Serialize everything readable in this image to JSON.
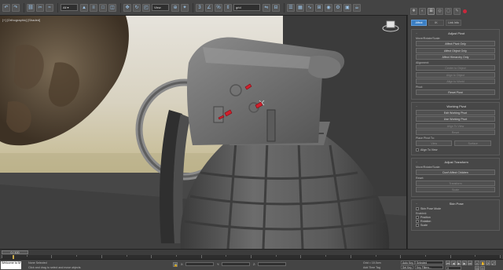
{
  "toolbar": {
    "view_select": "View",
    "layer_select": "grid",
    "icons": [
      "undo-icon",
      "redo-icon",
      "link-icon",
      "unlink-icon",
      "bind-icon",
      "select-icon",
      "select-by-name-icon",
      "region-icon",
      "move-icon",
      "rotate-icon",
      "scale-icon",
      "reference-icon",
      "pivot-icon",
      "snap-icon",
      "angle-snap-icon",
      "percent-snap-icon",
      "spinner-snap-icon",
      "named-selection-icon",
      "mirror-icon",
      "align-icon",
      "layer-icon",
      "graphite-icon",
      "curve-editor-icon",
      "schematic-icon",
      "material-editor-icon",
      "render-setup-icon",
      "rendered-frame-icon",
      "render-icon"
    ]
  },
  "viewport": {
    "label": "[+] [Orthographic] [Shaded]"
  },
  "command_panel": {
    "sub_tabs": [
      "Affect",
      "IK",
      "Link Info"
    ],
    "active_sub_tab": "Affect",
    "adjust_pivot": {
      "title": "Adjust Pivot",
      "move_rotate_scale": "Move/Rotate/Scale:",
      "buttons": [
        "Affect Pivot Only",
        "Affect Object Only",
        "Affect Hierarchy Only"
      ],
      "alignment_label": "Alignment:",
      "align_buttons": [
        "Center to Object",
        "Align to Object",
        "Align to World"
      ],
      "pivot_label": "Pivot:",
      "reset_pivot": "Reset Pivot"
    },
    "working_pivot": {
      "title": "Working Pivot",
      "buttons": [
        "Edit Working Pivot",
        "Use Working Pivot",
        "Align To View",
        "Reset"
      ],
      "place_pivot_to": "Place Pivot To:",
      "view_option": "View",
      "surface_option": "Surface",
      "align_to_view": "Align To View"
    },
    "adjust_transform": {
      "title": "Adjust Transform",
      "move_rotate_scale": "Move/Rotate/Scale:",
      "dont_affect_children": "Don't Affect Children",
      "reset_label": "Reset:",
      "reset_buttons": [
        "Transform",
        "Scale"
      ]
    },
    "skin_pose": {
      "title": "Skin Pose",
      "skin_pose_mode": "Skin Pose Mode",
      "enabled_label": "Enabled:",
      "options": [
        "Position",
        "Rotation",
        "Scale"
      ]
    }
  },
  "timeline": {
    "slider_label": "0 / 100",
    "accent": "#c8a84a"
  },
  "statusbar": {
    "script_text": "Welcome to M",
    "status_main": "None Selected",
    "prompt": "Click and drag to select and move objects",
    "x_label": "X:",
    "y_label": "Y:",
    "z_label": "Z:",
    "grid_label": "Grid = 10.0cm",
    "add_time_tag": "Add Time Tag",
    "auto_key": "Auto Key",
    "selected": "Selected",
    "set_key": "Set Key",
    "key_filters": "Key Filters...",
    "frame": "0"
  },
  "colors": {
    "panel": "#444444",
    "viewport_bg": "#3a3a3a",
    "accent_blue": "#3b7fc4",
    "marker_red": "#d0202c"
  }
}
